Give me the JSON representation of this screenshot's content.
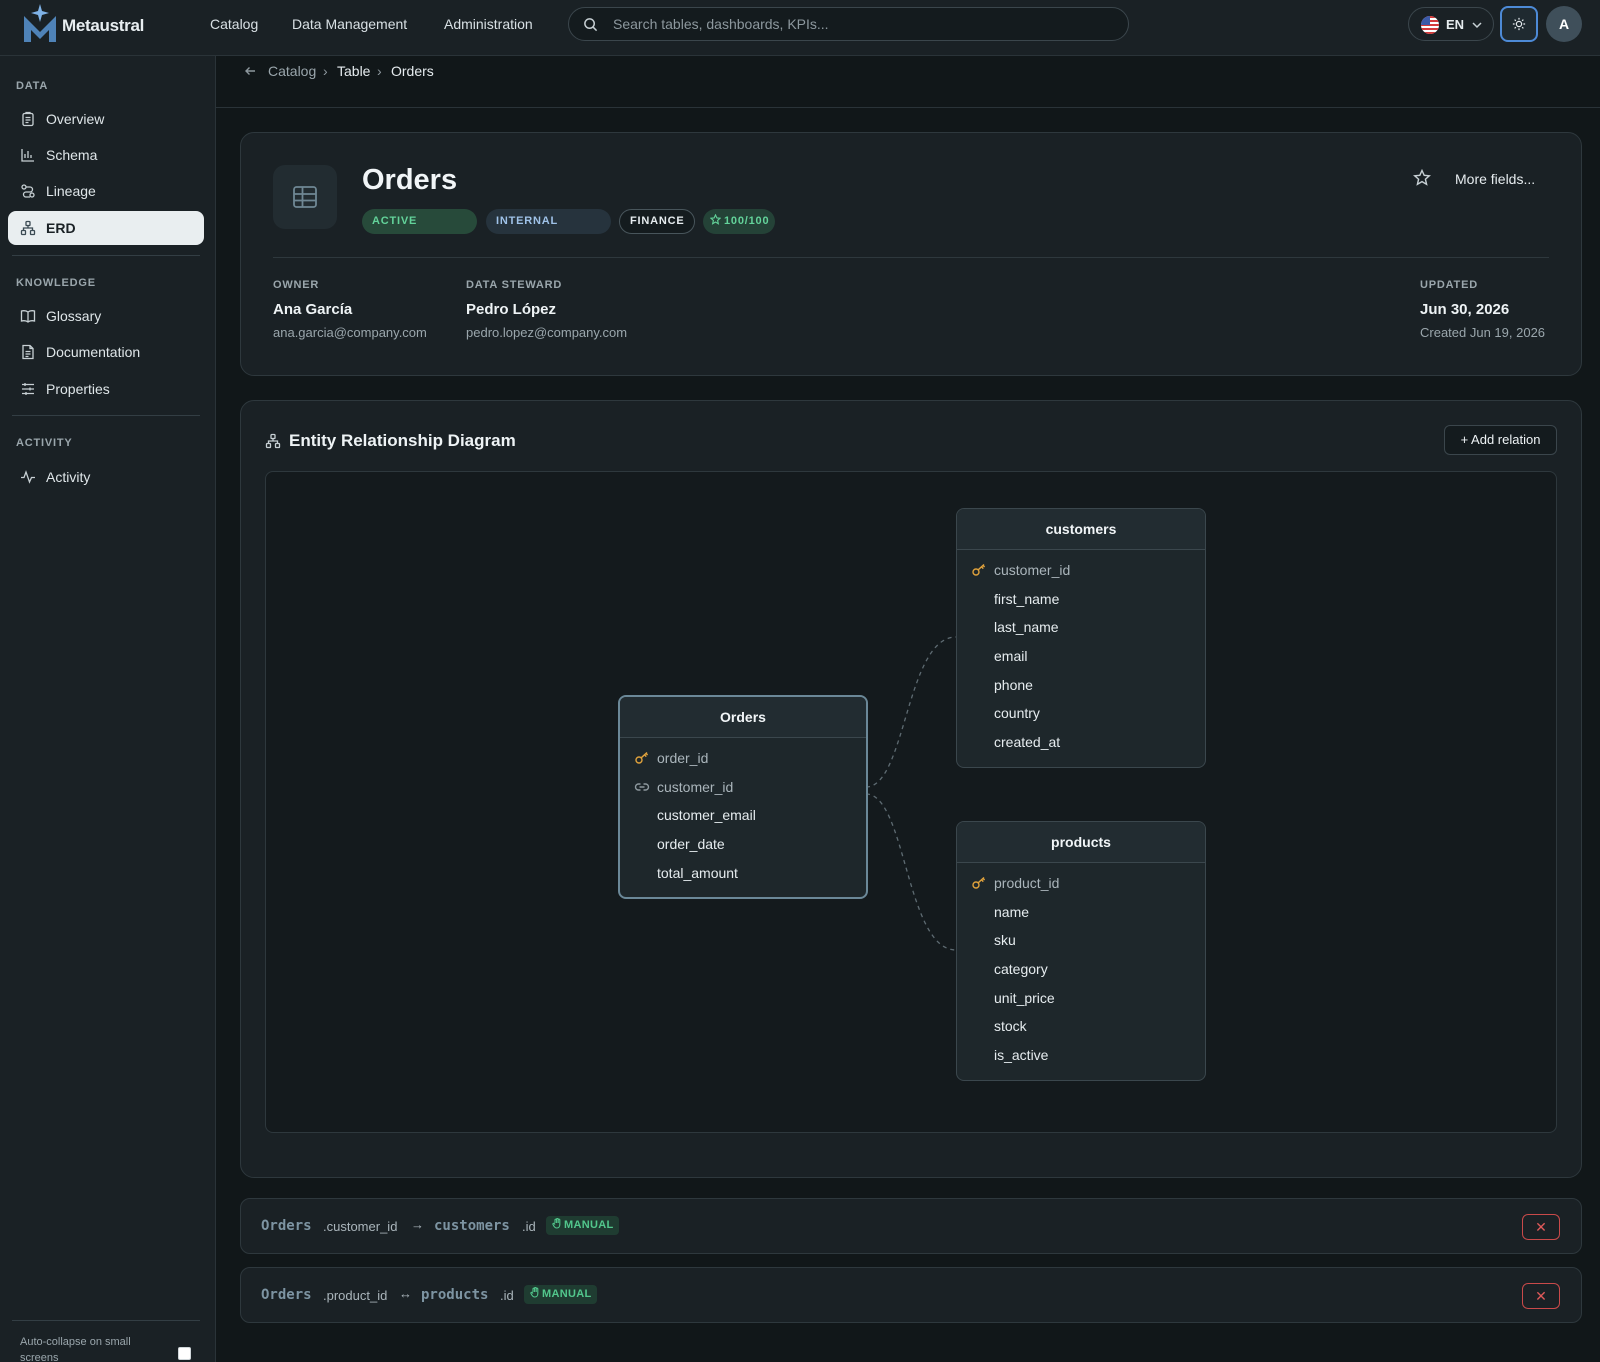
{
  "app": {
    "name": "Metaustral"
  },
  "topnav": {
    "items": [
      "Catalog",
      "Data Management",
      "Administration"
    ]
  },
  "search": {
    "placeholder": "Search tables, dashboards, KPIs..."
  },
  "lang": {
    "code": "EN"
  },
  "user": {
    "initial": "A"
  },
  "sidebar": {
    "sections": [
      {
        "title": "DATA",
        "items": [
          {
            "label": "Overview",
            "icon": "clipboard-icon"
          },
          {
            "label": "Schema",
            "icon": "bar-chart-icon"
          },
          {
            "label": "Lineage",
            "icon": "route-icon"
          },
          {
            "label": "ERD",
            "icon": "network-icon",
            "active": true
          }
        ]
      },
      {
        "title": "KNOWLEDGE",
        "items": [
          {
            "label": "Glossary",
            "icon": "book-icon"
          },
          {
            "label": "Documentation",
            "icon": "document-icon"
          },
          {
            "label": "Properties",
            "icon": "sliders-icon"
          }
        ]
      },
      {
        "title": "ACTIVITY",
        "items": [
          {
            "label": "Activity",
            "icon": "pulse-icon"
          }
        ]
      }
    ],
    "auto_collapse_label": "Auto-collapse on small screens",
    "auto_collapse_checked": false
  },
  "breadcrumb": {
    "items": [
      "Catalog",
      "Table",
      "Orders"
    ]
  },
  "asset": {
    "title": "Orders",
    "badges": {
      "status": "ACTIVE",
      "classification": "INTERNAL",
      "domain": "FINANCE",
      "score": "100/100"
    },
    "more_fields": "More fields...",
    "owner": {
      "label": "OWNER",
      "name": "Ana García",
      "email": "ana.garcia@company.com"
    },
    "steward": {
      "label": "DATA STEWARD",
      "name": "Pedro López",
      "email": "pedro.lopez@company.com"
    },
    "updated": {
      "label": "UPDATED",
      "date": "Jun 30, 2026",
      "created": "Created Jun 19, 2026"
    }
  },
  "erd": {
    "title": "Entity Relationship Diagram",
    "add_relation": "+ Add relation",
    "entities": [
      {
        "name": "Orders",
        "columns": [
          {
            "name": "order_id",
            "kind": "pk"
          },
          {
            "name": "customer_id",
            "kind": "fk"
          },
          {
            "name": "customer_email",
            "kind": ""
          },
          {
            "name": "order_date",
            "kind": ""
          },
          {
            "name": "total_amount",
            "kind": ""
          }
        ]
      },
      {
        "name": "customers",
        "columns": [
          {
            "name": "customer_id",
            "kind": "pk"
          },
          {
            "name": "first_name",
            "kind": ""
          },
          {
            "name": "last_name",
            "kind": ""
          },
          {
            "name": "email",
            "kind": ""
          },
          {
            "name": "phone",
            "kind": ""
          },
          {
            "name": "country",
            "kind": ""
          },
          {
            "name": "created_at",
            "kind": ""
          }
        ]
      },
      {
        "name": "products",
        "columns": [
          {
            "name": "product_id",
            "kind": "pk"
          },
          {
            "name": "name",
            "kind": ""
          },
          {
            "name": "sku",
            "kind": ""
          },
          {
            "name": "category",
            "kind": ""
          },
          {
            "name": "unit_price",
            "kind": ""
          },
          {
            "name": "stock",
            "kind": ""
          },
          {
            "name": "is_active",
            "kind": ""
          }
        ]
      }
    ]
  },
  "relations": [
    {
      "source_table": "Orders",
      "source_field": ".customer_id",
      "arrow": "→",
      "target_table": "customers",
      "target_field": ".id",
      "type": "MANUAL"
    },
    {
      "source_table": "Orders",
      "source_field": ".product_id",
      "arrow": "↔",
      "target_table": "products",
      "target_field": ".id",
      "type": "MANUAL"
    }
  ],
  "colors": {
    "accent": "#4d8ad6",
    "success": "#63d39a",
    "danger": "#e05a5a",
    "pk_key": "#e0a23c"
  }
}
